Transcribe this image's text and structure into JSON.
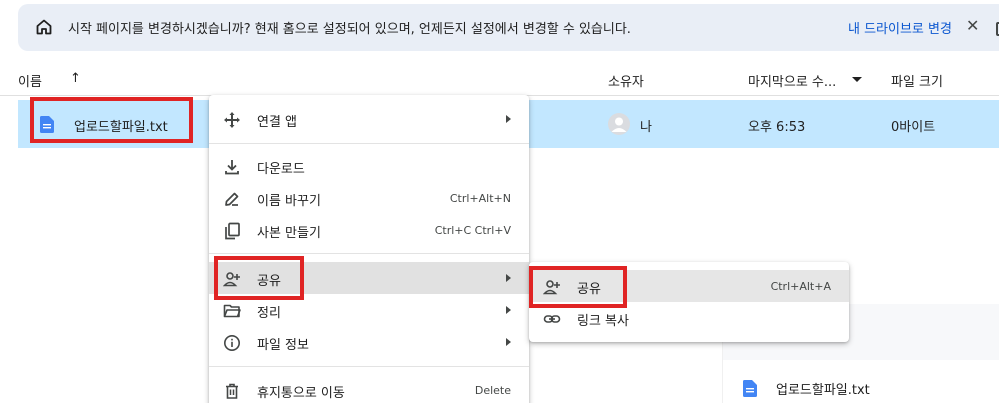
{
  "banner": {
    "message": "시작 페이지를 변경하시겠습니까? 현재 홈으로 설정되어 있으며, 언제든지 설정에서 변경할 수 있습니다.",
    "action": "내 드라이브로 변경",
    "close": "✕"
  },
  "header": {
    "name": "이름",
    "sort_arrow": "↑",
    "owner": "소유자",
    "modified": "마지막으로 수...",
    "size": "파일 크기"
  },
  "file_row": {
    "name": "업로드할파일.txt",
    "owner": "나",
    "modified": "오후 6:53",
    "size": "0바이트"
  },
  "context_menu": {
    "items": [
      {
        "label": "연결 앱",
        "shortcut": "",
        "icon": "move-arrows-icon"
      },
      {
        "label": "다운로드",
        "shortcut": "",
        "icon": "download-icon"
      },
      {
        "label": "이름 바꾸기",
        "shortcut": "Ctrl+Alt+N",
        "icon": "pencil-icon"
      },
      {
        "label": "사본 만들기",
        "shortcut": "Ctrl+C Ctrl+V",
        "icon": "copy-icon"
      },
      {
        "label": "공유",
        "shortcut": "",
        "icon": "person-add-icon"
      },
      {
        "label": "정리",
        "shortcut": "",
        "icon": "folder-open-icon"
      },
      {
        "label": "파일 정보",
        "shortcut": "",
        "icon": "info-icon"
      },
      {
        "label": "휴지통으로 이동",
        "shortcut": "Delete",
        "icon": "trash-icon"
      }
    ]
  },
  "share_submenu": {
    "items": [
      {
        "label": "공유",
        "shortcut": "Ctrl+Alt+A",
        "icon": "person-add-icon"
      },
      {
        "label": "링크 복사",
        "shortcut": "",
        "icon": "link-icon"
      }
    ]
  },
  "details_panel": {
    "file_name": "업로드할파일.txt"
  },
  "colors": {
    "selection": "#c2e7ff",
    "banner_bg": "#e9eef6",
    "link": "#0b57d0",
    "highlight_box": "#e02424",
    "doc_icon": "#4285f4"
  }
}
